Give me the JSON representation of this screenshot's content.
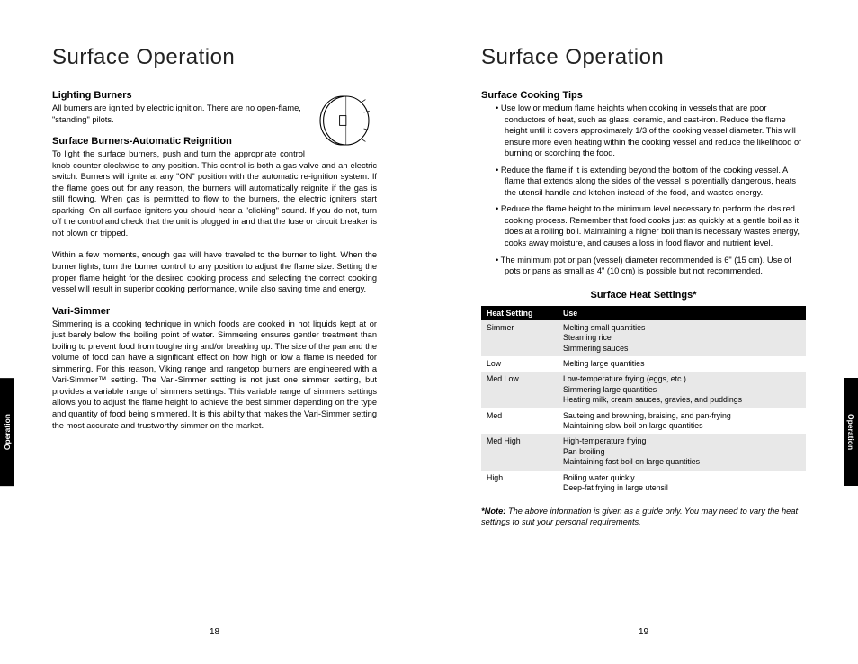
{
  "left": {
    "title": "Surface Operation",
    "tab": "Operation",
    "page_number": "18",
    "s1": {
      "heading": "Lighting Burners",
      "text": "All burners are ignited by electric ignition. There are no open-flame, \"standing\" pilots."
    },
    "s2": {
      "heading": "Surface Burners-Automatic Reignition",
      "p1": "To light the surface burners, push and turn the appropriate control knob counter clockwise to any position. This control is both a gas valve and an electric switch. Burners will ignite at any \"ON\" position with the automatic re-ignition system. If the flame goes out for any reason, the burners will automatically reignite if the gas is still flowing. When gas is permitted to flow to the burners, the electric igniters start sparking. On all surface igniters you should hear a \"clicking\" sound. If you do not, turn off the control and check that the unit is plugged in and that the fuse or circuit breaker is not blown or tripped.",
      "p2": "Within a few moments, enough gas will have traveled to the burner to light. When the burner lights, turn the burner control to any position to adjust the flame size. Setting the proper flame height for the desired cooking process and selecting the correct cooking vessel will result in superior cooking performance, while also saving time and energy."
    },
    "s3": {
      "heading": "Vari-Simmer",
      "text": "Simmering is a cooking technique in which foods are cooked in hot liquids kept at or just barely below the boiling point of water. Simmering ensures gentler treatment than boiling to prevent food from toughening and/or breaking up. The size of the pan and the volume of food can have a significant effect on how high or low a flame is needed for simmering. For this reason, Viking range and rangetop burners are engineered with a Vari-Simmer™ setting. The Vari-Simmer setting is not just one simmer setting, but provides a variable range of simmers settings. This variable range of simmers settings allows you to adjust the flame height to achieve the best simmer depending on the type and quantity of food being simmered. It is this ability that makes the Vari-Simmer setting the most accurate and trustworthy simmer on the market."
    }
  },
  "right": {
    "title": "Surface Operation",
    "tab": "Operation",
    "page_number": "19",
    "tips_heading": "Surface Cooking Tips",
    "tips": [
      "Use low or medium flame heights when cooking in vessels that are poor conductors of heat, such as glass, ceramic, and cast-iron. Reduce the flame height until it covers approximately 1/3 of the cooking vessel diameter. This will ensure more even heating within the cooking vessel and reduce the likelihood of burning or scorching the food.",
      "Reduce the flame if it is extending beyond the bottom of the cooking vessel. A flame that extends along the sides of the vessel is potentially dangerous, heats the utensil handle and kitchen instead of the food, and wastes energy.",
      "Reduce the flame height to the minimum level necessary to perform the desired cooking process. Remember that food cooks just as quickly at a gentle boil as it does at a rolling boil. Maintaining a higher boil than is necessary wastes energy, cooks away moisture, and causes a loss in food flavor and nutrient level.",
      "The minimum pot or pan (vessel) diameter recommended is 6\" (15 cm). Use of pots or pans as small as 4\" (10 cm) is possible but not recommended."
    ],
    "table_title": "Surface Heat Settings*",
    "table_headers": {
      "c1": "Heat Setting",
      "c2": "Use"
    },
    "table_rows": [
      {
        "setting": "Simmer",
        "use": "Melting small quantities\nSteaming rice\nSimmering sauces"
      },
      {
        "setting": "Low",
        "use": "Melting large quantities"
      },
      {
        "setting": "Med Low",
        "use": "Low-temperature frying (eggs, etc.)\nSimmering large quantities\nHeating milk, cream sauces, gravies, and puddings"
      },
      {
        "setting": "Med",
        "use": "Sauteing and browning, braising, and pan-frying\nMaintaining slow boil on large quantities"
      },
      {
        "setting": "Med High",
        "use": "High-temperature frying\nPan broiling\nMaintaining fast boil on large quantities"
      },
      {
        "setting": "High",
        "use": "Boiling water quickly\nDeep-fat frying in large utensil"
      }
    ],
    "note_label": "*Note:",
    "note_text": " The above information is given as a guide only. You may need to vary the heat settings to suit your personal requirements."
  }
}
